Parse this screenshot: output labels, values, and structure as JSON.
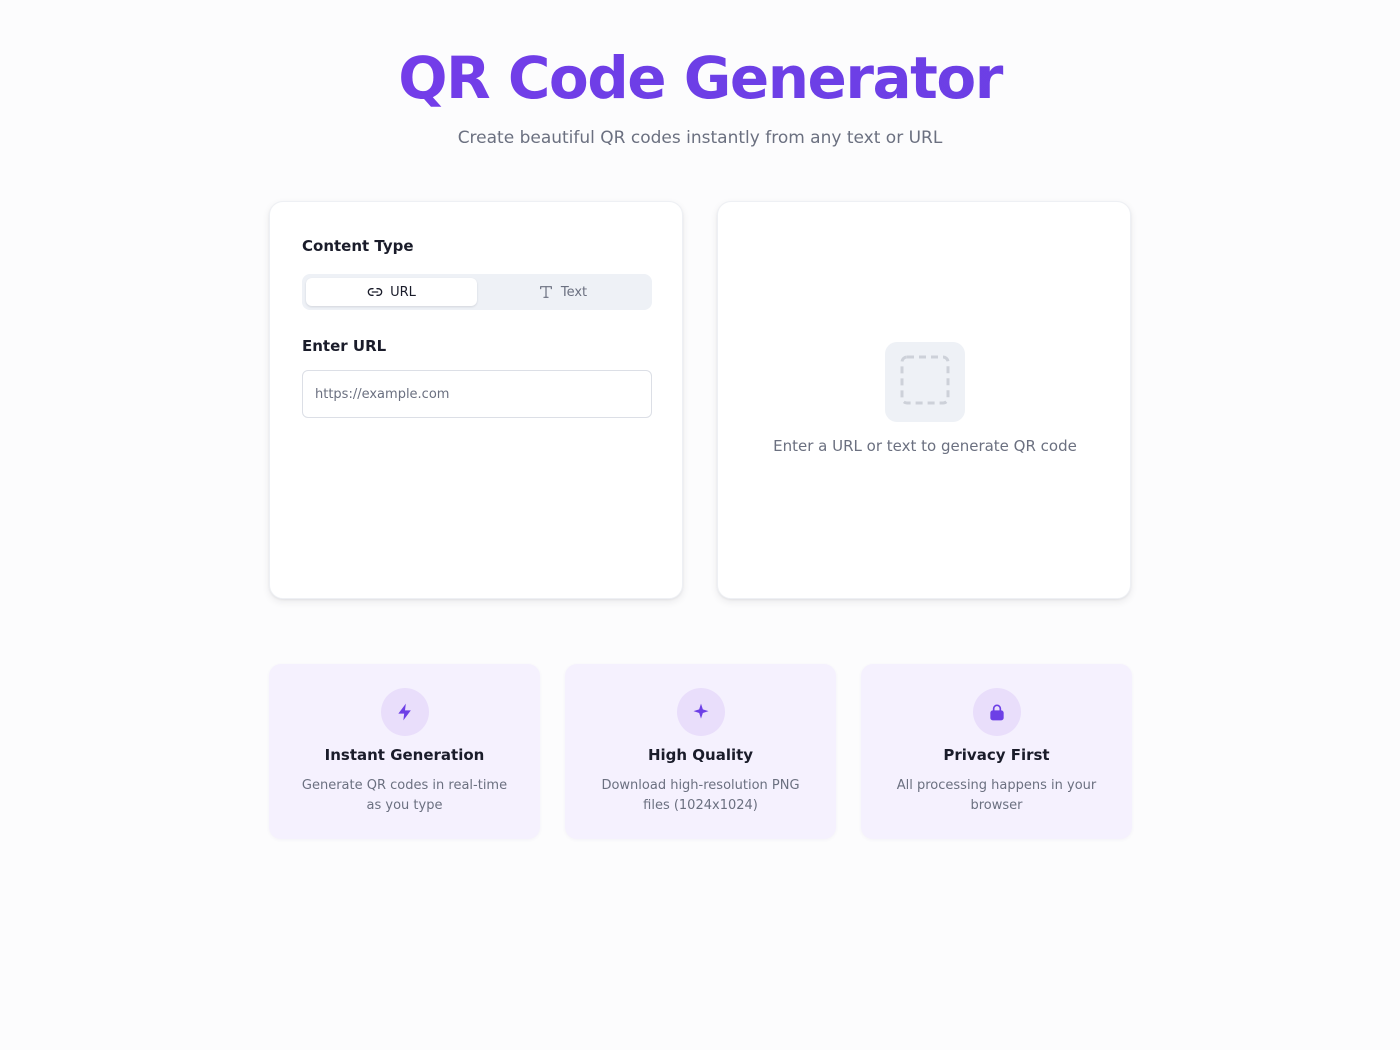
{
  "header": {
    "title": "QR Code Generator",
    "subtitle": "Create beautiful QR codes instantly from any text or URL"
  },
  "input_card": {
    "content_type_label": "Content Type",
    "tabs": [
      {
        "label": "URL",
        "icon": "link-icon",
        "active": true
      },
      {
        "label": "Text",
        "icon": "text-type-icon",
        "active": false
      }
    ],
    "enter_url_label": "Enter URL",
    "url_input": {
      "value": "",
      "placeholder": "https://example.com"
    }
  },
  "preview_card": {
    "icon": "dashed-square-icon",
    "empty_message": "Enter a URL or text to generate QR code"
  },
  "features": [
    {
      "icon": "lightning-icon",
      "title": "Instant Generation",
      "description": "Generate QR codes in real-time as you type"
    },
    {
      "icon": "sparkle-icon",
      "title": "High Quality",
      "description": "Download high-resolution PNG files (1024x1024)"
    },
    {
      "icon": "lock-icon",
      "title": "Privacy First",
      "description": "All processing happens in your browser"
    }
  ],
  "colors": {
    "accent": "#6d3fe6",
    "feature_bg": "#f5f1fe",
    "feature_icon_bg": "#e9defb",
    "muted_text": "#6b7080"
  }
}
